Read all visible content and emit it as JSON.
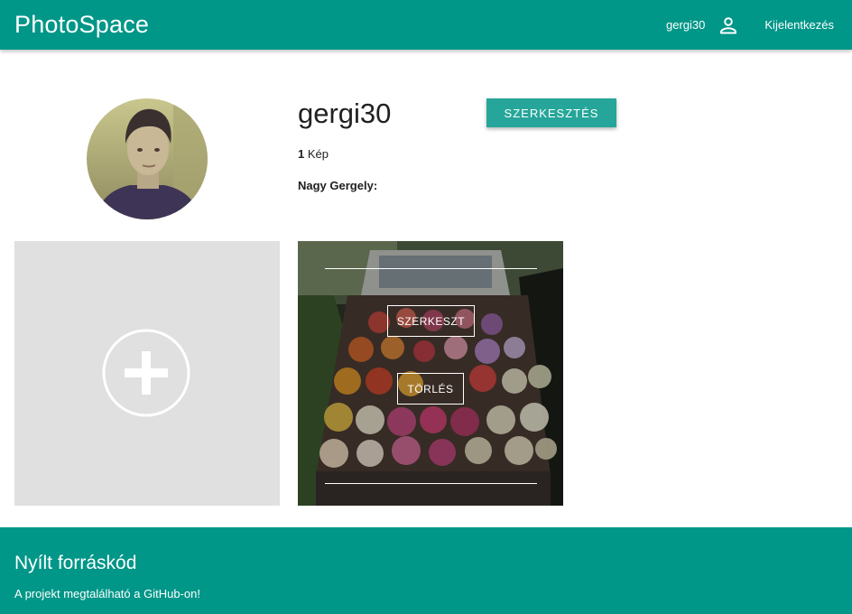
{
  "app": {
    "brand": "PhotoSpace"
  },
  "nav": {
    "username": "gergi30",
    "user_icon": "person-icon",
    "logout_label": "Kijelentkezés"
  },
  "profile": {
    "username": "gergi30",
    "edit_button_label": "SZERKESZTÉS",
    "image_count": "1",
    "image_count_label": "Kép",
    "full_name": "Nagy Gergely:"
  },
  "gallery": {
    "add_icon": "plus-circle-icon",
    "photos": [
      {
        "edit_label": "SZERKESZT",
        "delete_label": "TÖRLÉS"
      }
    ]
  },
  "footer": {
    "title": "Nyílt forráskód",
    "text": "A projekt megtalálható a GitHub-on!"
  },
  "colors": {
    "primary": "#009688",
    "button": "#26a69a",
    "tile_bg": "#e0e0e0"
  }
}
